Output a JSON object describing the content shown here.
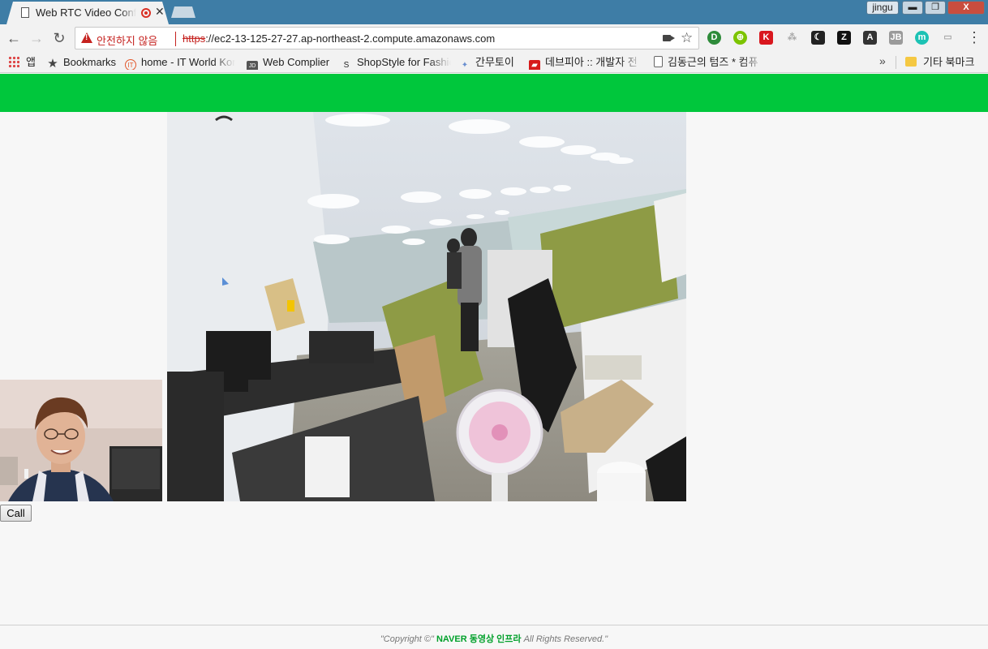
{
  "browser": {
    "tab_title": "Web RTC Video Conf",
    "profile": "jingu",
    "window_buttons": {
      "minimize": "▬",
      "restore": "❐",
      "close": "X"
    },
    "security_label": "안전하지 않음",
    "url_protocol": "https",
    "url_rest": "://ec2-13-125-27-27.ap-northeast-2.compute.amazonaws.com",
    "icons": [
      "back-arrow-icon",
      "forward-arrow-icon",
      "reload-icon",
      "warning-icon",
      "camera-icon",
      "star-icon",
      "menu-icon"
    ]
  },
  "extensions": [
    {
      "label": "D",
      "color": "#2e8b3a"
    },
    {
      "label": "⊕",
      "color": "#7cc400"
    },
    {
      "label": "K",
      "color": "#d9171e"
    },
    {
      "label": "⁂",
      "color": "#c9c9c9"
    },
    {
      "label": "☾",
      "color": "#222222"
    },
    {
      "label": "Z",
      "color": "#111111"
    },
    {
      "label": "A",
      "color": "#333333"
    },
    {
      "label": "JB",
      "color": "#9a9a9a"
    },
    {
      "label": "m",
      "color": "#1cc2b4"
    },
    {
      "label": "▭",
      "color": "#cfcfcf"
    }
  ],
  "bookmarks": {
    "apps": "앱",
    "items": [
      {
        "label": "Bookmarks",
        "icon": "★",
        "color": "transparent"
      },
      {
        "label": "home - IT World Kor",
        "icon": "IT",
        "color": "#e2572a"
      },
      {
        "label": "Web Complier",
        "icon": "JD",
        "color": "#555555"
      },
      {
        "label": "ShopStyle for Fashion",
        "icon": "S",
        "color": "#ffffff"
      },
      {
        "label": "간무토이",
        "icon": "✦",
        "color": "transparent"
      },
      {
        "label": "데브피아 :: 개발자 전",
        "icon": "▰",
        "color": "#d71b1b"
      },
      {
        "label": "김동근의 텀즈 * 컴퓨",
        "icon": "",
        "color": "transparent"
      }
    ],
    "overflow": "»",
    "other": "기타 북마크"
  },
  "page": {
    "call_label": "Call",
    "footer_prefix": "\"Copyright ©\"",
    "footer_brand": "NAVER 동영상 인프라",
    "footer_suffix": "All Rights Reserved.\"",
    "colors": {
      "header": "#00c73c",
      "brand": "#00a02a"
    }
  }
}
